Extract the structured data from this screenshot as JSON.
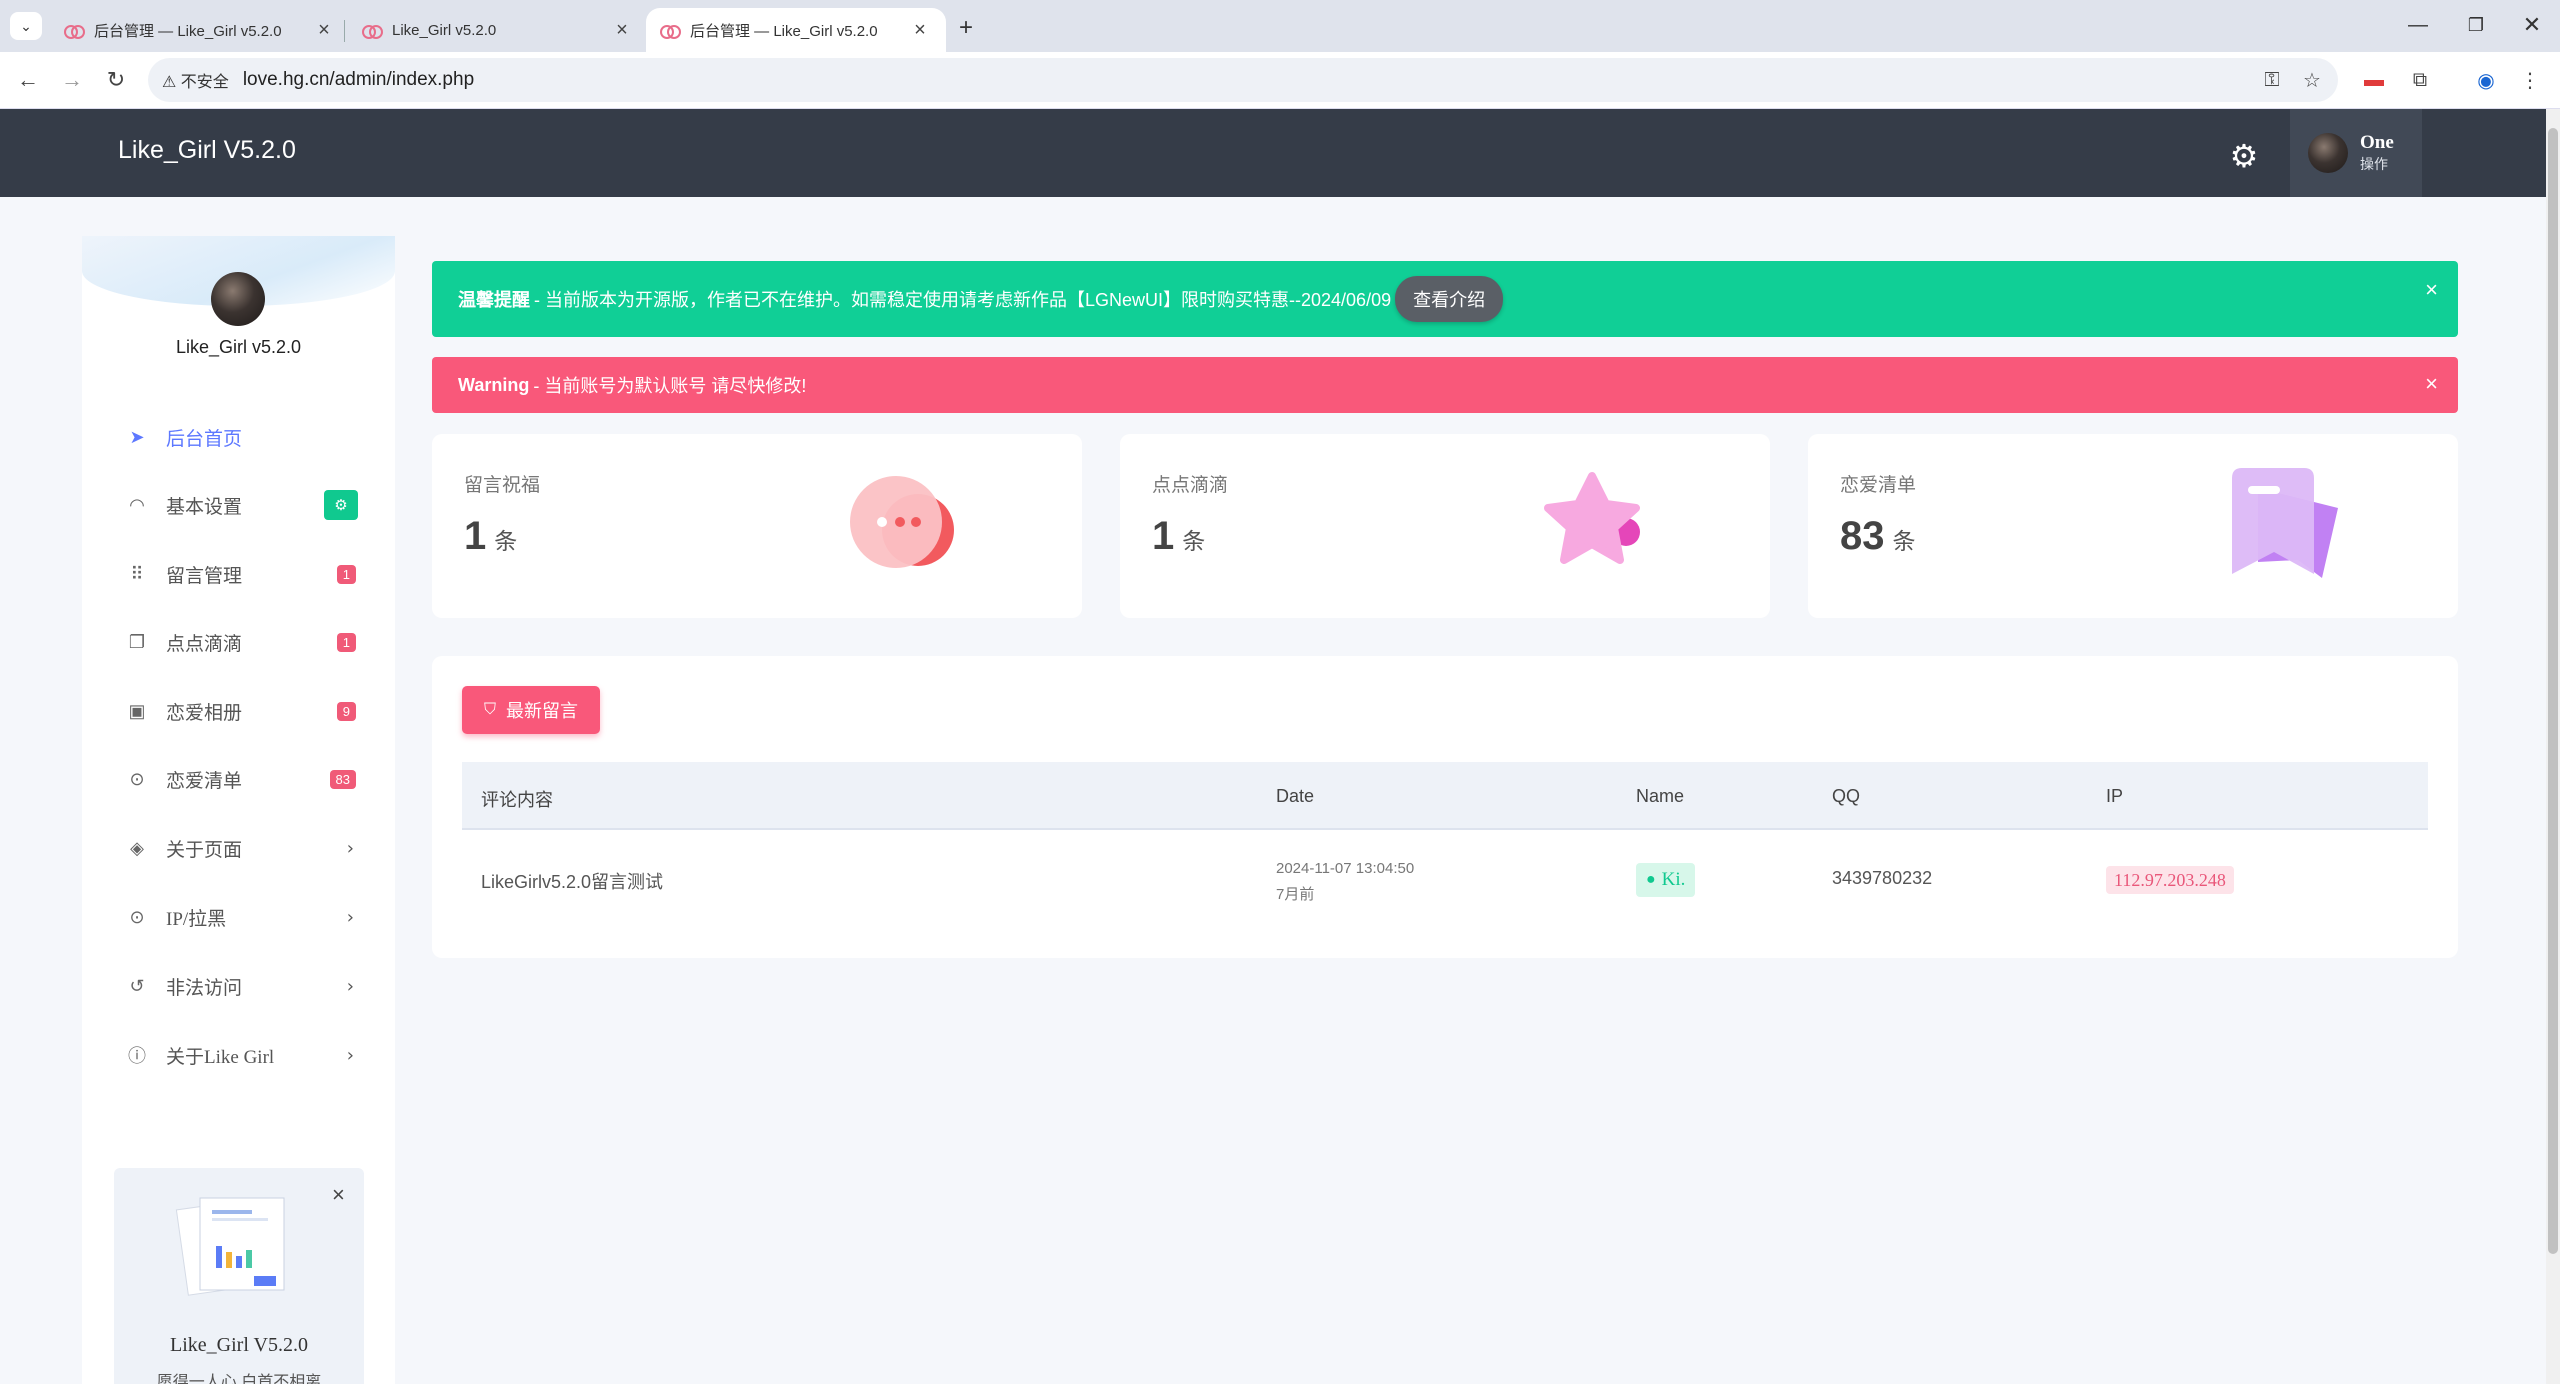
{
  "browser": {
    "tabs": [
      {
        "title": "后台管理 — Like_Girl v5.2.0",
        "active": false
      },
      {
        "title": "Like_Girl v5.2.0",
        "active": false
      },
      {
        "title": "后台管理 — Like_Girl v5.2.0",
        "active": true
      }
    ],
    "new_tab": "+",
    "security_label": "不安全",
    "url": "love.hg.cn/admin/index.php",
    "window_controls": [
      "minimize",
      "restore",
      "close"
    ]
  },
  "header": {
    "brand": "Like_Girl V5.2.0",
    "user_name": "One",
    "user_role": "操作",
    "icons": [
      "gear-icon"
    ]
  },
  "sidebar": {
    "site_name": "Like_Girl v5.2.0",
    "items": [
      {
        "label": "后台首页",
        "icon": "send-icon",
        "active": true
      },
      {
        "label": "基本设置",
        "icon": "gauge-icon",
        "badge": "⚙"
      },
      {
        "label": "留言管理",
        "icon": "grid-icon",
        "badge": "1"
      },
      {
        "label": "点点滴滴",
        "icon": "clipboard-icon",
        "badge": "1"
      },
      {
        "label": "恋爱相册",
        "icon": "photo-icon",
        "badge": "9"
      },
      {
        "label": "恋爱清单",
        "icon": "pin-icon",
        "badge": "83"
      },
      {
        "label": "关于页面",
        "icon": "tag-icon",
        "chevron": true
      },
      {
        "label": "IP/拉黑",
        "icon": "pin-icon",
        "chevron": true
      },
      {
        "label": "非法访问",
        "icon": "history-icon",
        "chevron": true
      },
      {
        "label": "关于Like Girl",
        "icon": "info-icon",
        "chevron": true
      }
    ],
    "promo": {
      "title": "Like_Girl V5.2.0",
      "subtitle": "愿得一人心 白首不相离"
    }
  },
  "alerts": [
    {
      "type": "success",
      "strong": "温馨提醒",
      "text": " - 当前版本为开源版，作者已不在维护。如需稳定使用请考虑新作品【LGNewUI】限时购买特惠--2024/06/09",
      "button": "查看介绍"
    },
    {
      "type": "danger",
      "strong": "Warning",
      "text": " - 当前账号为默认账号 请尽快修改!"
    }
  ],
  "stats": [
    {
      "label": "留言祝福",
      "value": "1",
      "unit": "条",
      "color": "#f36b74"
    },
    {
      "label": "点点滴滴",
      "value": "1",
      "unit": "条",
      "color": "#f27bd0"
    },
    {
      "label": "恋爱清单",
      "value": "83",
      "unit": "条",
      "color": "#b98af5"
    }
  ],
  "messages": {
    "button": "最新留言",
    "columns": [
      "评论内容",
      "Date",
      "Name",
      "QQ",
      "IP"
    ],
    "rows": [
      {
        "content": "LikeGirlv5.2.0留言测试",
        "date": "2024-11-07 13:04:50",
        "relative": "7月前",
        "name": "Ki.",
        "qq": "3439780232",
        "ip": "112.97.203.248"
      }
    ]
  },
  "colors": {
    "header_bg": "#353c48",
    "accent": "#5d78ff",
    "success": "#10cf96",
    "danger": "#f9587a"
  }
}
